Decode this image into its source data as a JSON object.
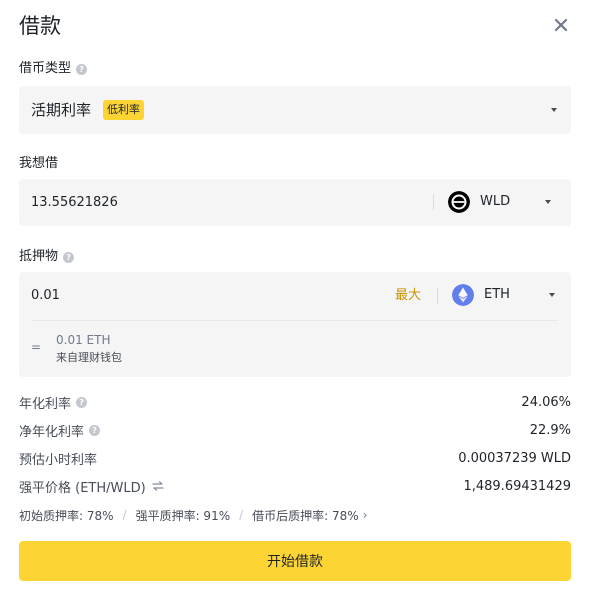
{
  "title": "借款",
  "loan_type": {
    "label": "借币类型",
    "value": "活期利率",
    "badge": "低利率"
  },
  "borrow": {
    "label": "我想借",
    "amount": "13.55621826",
    "coin": "WLD"
  },
  "collateral": {
    "label": "抵押物",
    "amount": "0.01",
    "max_label": "最大",
    "coin": "ETH",
    "equals": "=",
    "source_amount": "0.01 ETH",
    "source_note": "来自理财钱包"
  },
  "summary": [
    {
      "label": "年化利率",
      "value": "24.06%",
      "help": true
    },
    {
      "label": "净年化利率",
      "value": "22.9%",
      "help": true
    },
    {
      "label": "预估小时利率",
      "value": "0.00037239 WLD",
      "help": false
    },
    {
      "label": "强平价格 (ETH/WLD)",
      "value": "1,489.69431429",
      "help": false
    }
  ],
  "ratios": {
    "initial": "初始质押率:  78%",
    "liquidation": "强平质押率:  91%",
    "after": "借币后质押率:  78%"
  },
  "submit_label": "开始借款",
  "colors": {
    "accent": "#fcd535",
    "max_text": "#c99400",
    "field_bg": "#f5f5f5",
    "eth": "#627eea",
    "wld": "#000000"
  }
}
